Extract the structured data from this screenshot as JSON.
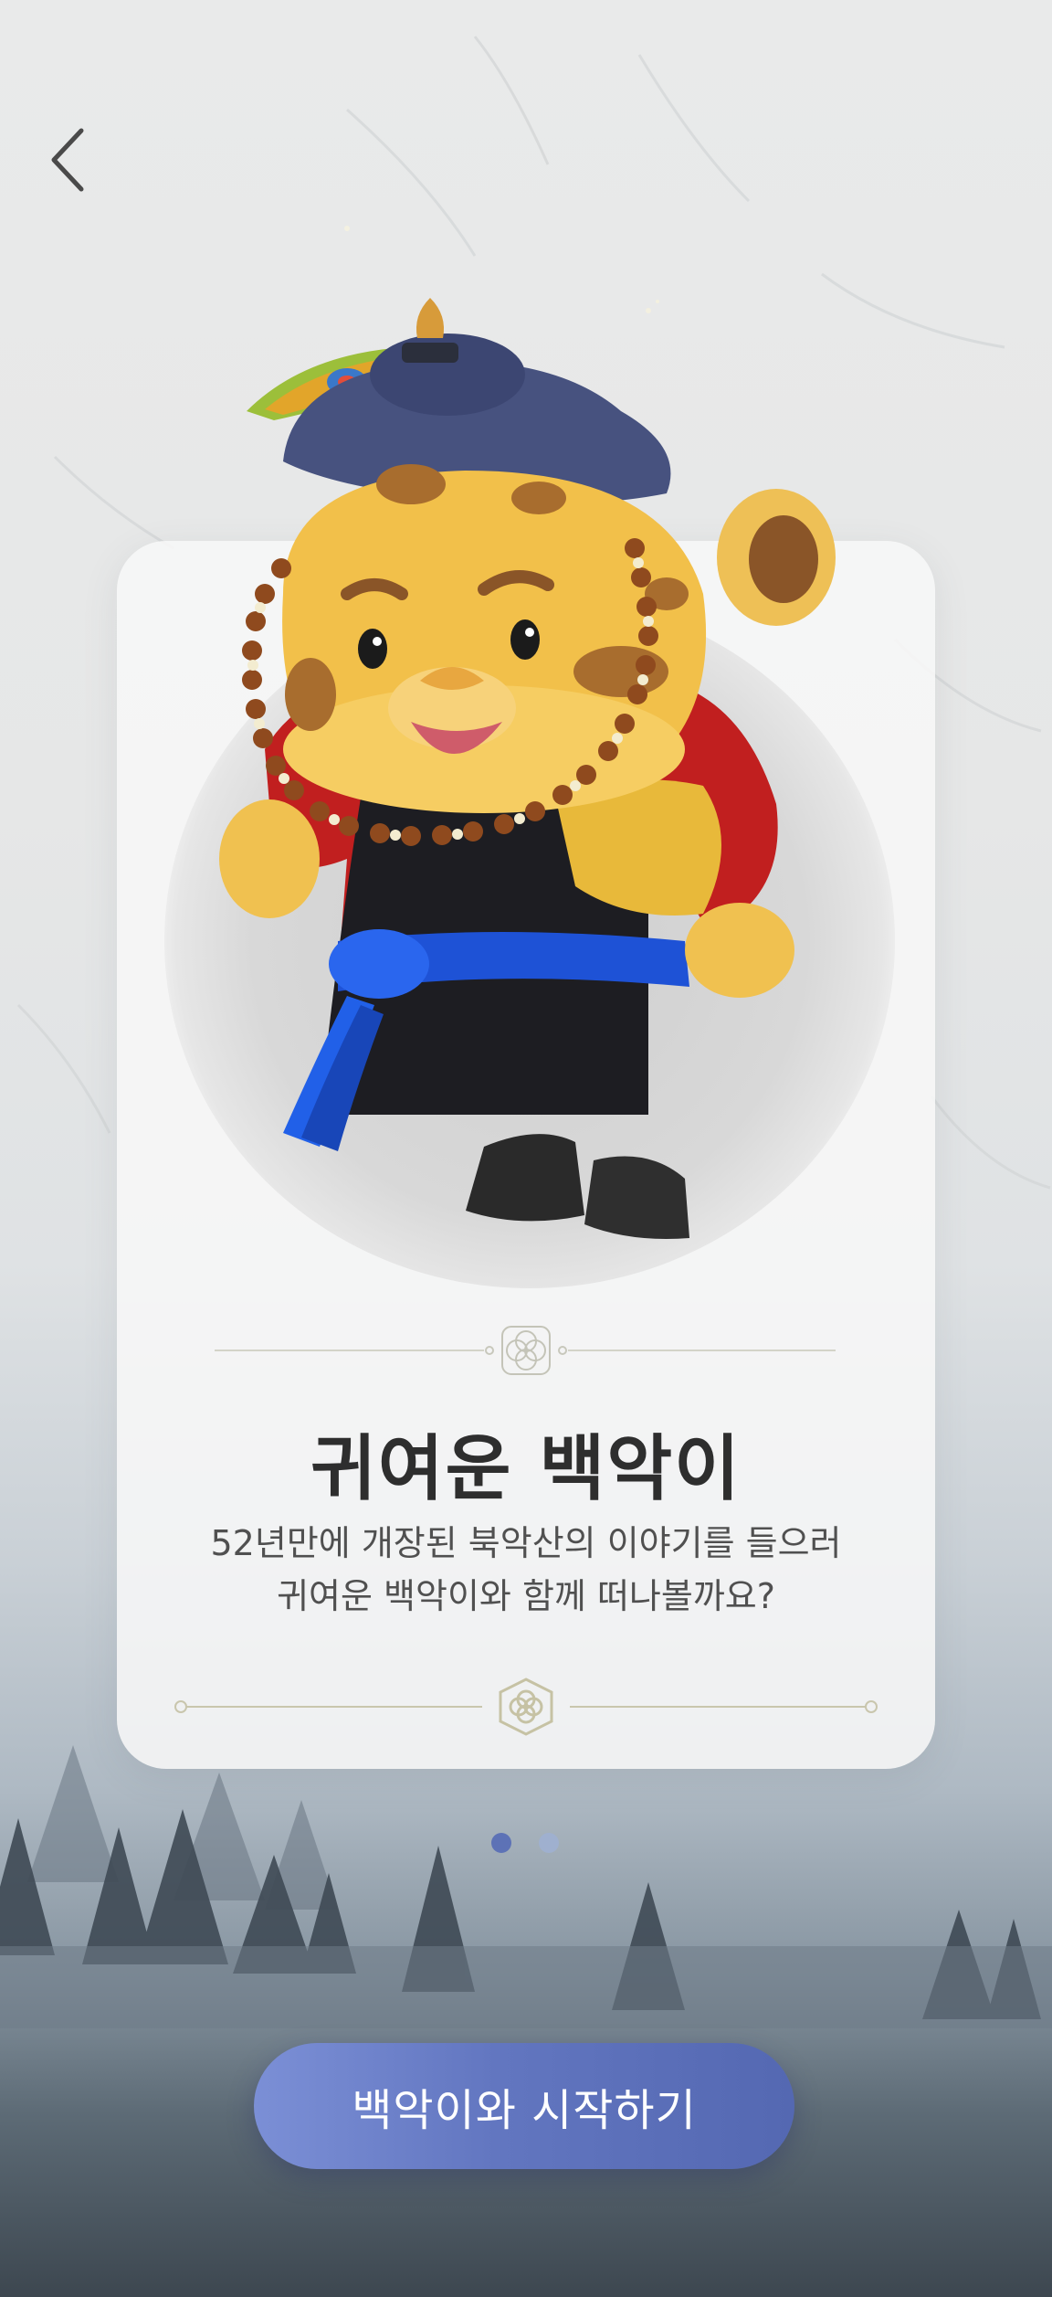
{
  "nav": {
    "back_icon": "chevron-left-icon"
  },
  "card": {
    "title": "귀여운 백악이",
    "description_line1": "52년만에 개장된 북악산의 이야기를 들으러",
    "description_line2": "귀여운 백악이와 함께 떠나볼까요?"
  },
  "pagination": {
    "current": 1,
    "total": 2
  },
  "cta": {
    "label": "백악이와 시작하기"
  },
  "colors": {
    "accent": "#5d72b6",
    "dot_inactive": "#9fb0cf",
    "button_start": "#7b8fd6",
    "button_end": "#5468b2",
    "title": "#2e2e2e",
    "text": "#505050"
  }
}
